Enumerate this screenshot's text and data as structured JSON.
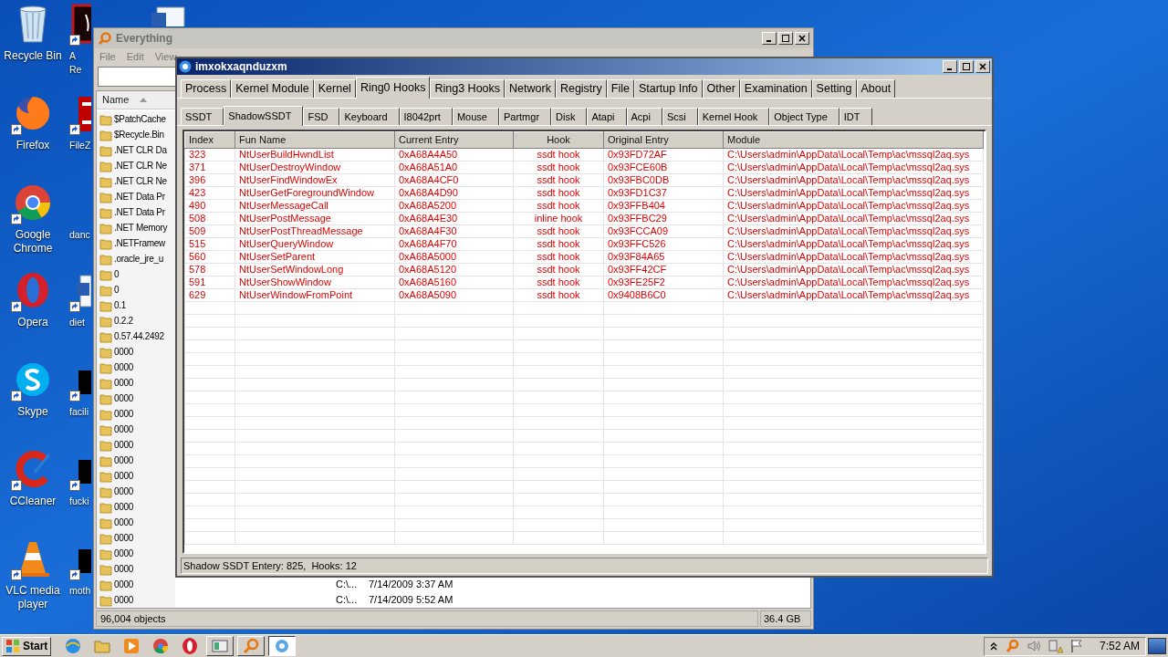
{
  "desktop_icons": [
    {
      "lines": [
        "Recycle Bin"
      ]
    },
    {
      "lines": [
        "Firefox"
      ]
    },
    {
      "lines": [
        "Google",
        "Chrome"
      ]
    },
    {
      "lines": [
        "Opera"
      ]
    },
    {
      "lines": [
        "Skype"
      ]
    },
    {
      "lines": [
        "CCleaner"
      ]
    },
    {
      "lines": [
        "VLC media",
        "player"
      ]
    },
    {
      "lines": [
        "A",
        "Re"
      ]
    },
    {
      "lines": [
        "FileZ"
      ]
    },
    {
      "lines": [
        "danc"
      ]
    },
    {
      "lines": [
        "diet"
      ]
    },
    {
      "lines": [
        "facili"
      ]
    },
    {
      "lines": [
        "fucki"
      ]
    },
    {
      "lines": [
        "moth"
      ]
    }
  ],
  "everything": {
    "title": "Everything",
    "menu": [
      "File",
      "Edit",
      "View"
    ],
    "column": "Name",
    "rows": [
      {
        "name": "$PatchCache"
      },
      {
        "name": "$Recycle.Bin"
      },
      {
        "name": ".NET CLR Da"
      },
      {
        "name": ".NET CLR Ne"
      },
      {
        "name": ".NET CLR Ne"
      },
      {
        "name": ".NET Data Pr"
      },
      {
        "name": ".NET Data Pr"
      },
      {
        "name": ".NET Memory"
      },
      {
        "name": ".NETFramew"
      },
      {
        "name": ".oracle_jre_u"
      },
      {
        "name": "0"
      },
      {
        "name": "0"
      },
      {
        "name": "0.1"
      },
      {
        "name": "0.2.2"
      },
      {
        "name": "0.57.44.2492"
      },
      {
        "name": "0000"
      },
      {
        "name": "0000"
      },
      {
        "name": "0000"
      },
      {
        "name": "0000"
      },
      {
        "name": "0000"
      },
      {
        "name": "0000"
      },
      {
        "name": "0000"
      },
      {
        "name": "0000"
      },
      {
        "name": "0000"
      },
      {
        "name": "0000"
      },
      {
        "name": "0000"
      },
      {
        "name": "0000"
      },
      {
        "name": "0000"
      },
      {
        "name": "0000"
      },
      {
        "name": "0000"
      },
      {
        "name": "0000",
        "path": "C:\\...",
        "date": "7/14/2009 3:37 AM"
      },
      {
        "name": "0000",
        "path": "C:\\...",
        "date": "7/14/2009 5:52 AM"
      }
    ],
    "status": "96,004 objects",
    "size": "36.4 GB"
  },
  "tool": {
    "title": "imxokxaqnduzxm",
    "tabs": [
      {
        "label": "Process",
        "selected": false
      },
      {
        "label": "Kernel Module",
        "selected": false
      },
      {
        "label": "Kernel",
        "selected": false
      },
      {
        "label": "Ring0 Hooks",
        "selected": true
      },
      {
        "label": "Ring3 Hooks",
        "selected": false
      },
      {
        "label": "Network",
        "selected": false
      },
      {
        "label": "Registry",
        "selected": false
      },
      {
        "label": "File",
        "selected": false
      },
      {
        "label": "Startup Info",
        "selected": false
      },
      {
        "label": "Other",
        "selected": false
      },
      {
        "label": "Examination",
        "selected": false
      },
      {
        "label": "Setting",
        "selected": false
      },
      {
        "label": "About",
        "selected": false
      }
    ],
    "subtabs": [
      {
        "label": "SSDT",
        "selected": false
      },
      {
        "label": "ShadowSSDT",
        "selected": true
      },
      {
        "label": "FSD",
        "selected": false
      },
      {
        "label": "Keyboard",
        "selected": false
      },
      {
        "label": "I8042prt",
        "selected": false
      },
      {
        "label": "Mouse",
        "selected": false
      },
      {
        "label": "Partmgr",
        "selected": false
      },
      {
        "label": "Disk",
        "selected": false
      },
      {
        "label": "Atapi",
        "selected": false
      },
      {
        "label": "Acpi",
        "selected": false
      },
      {
        "label": "Scsi",
        "selected": false
      },
      {
        "label": "Kernel Hook",
        "selected": false
      },
      {
        "label": "Object Type",
        "selected": false
      },
      {
        "label": "IDT",
        "selected": false
      }
    ],
    "columns": [
      "Index",
      "Fun Name",
      "Current Entry",
      "Hook",
      "Original Entry",
      "Module"
    ],
    "rows": [
      [
        "323",
        "NtUserBuildHwndList",
        "0xA68A4A50",
        "ssdt hook",
        "0x93FD72AF",
        "C:\\Users\\admin\\AppData\\Local\\Temp\\ac\\mssql2aq.sys"
      ],
      [
        "371",
        "NtUserDestroyWindow",
        "0xA68A51A0",
        "ssdt hook",
        "0x93FCE60B",
        "C:\\Users\\admin\\AppData\\Local\\Temp\\ac\\mssql2aq.sys"
      ],
      [
        "396",
        "NtUserFindWindowEx",
        "0xA68A4CF0",
        "ssdt hook",
        "0x93FBC0DB",
        "C:\\Users\\admin\\AppData\\Local\\Temp\\ac\\mssql2aq.sys"
      ],
      [
        "423",
        "NtUserGetForegroundWindow",
        "0xA68A4D90",
        "ssdt hook",
        "0x93FD1C37",
        "C:\\Users\\admin\\AppData\\Local\\Temp\\ac\\mssql2aq.sys"
      ],
      [
        "490",
        "NtUserMessageCall",
        "0xA68A5200",
        "ssdt hook",
        "0x93FFB404",
        "C:\\Users\\admin\\AppData\\Local\\Temp\\ac\\mssql2aq.sys"
      ],
      [
        "508",
        "NtUserPostMessage",
        "0xA68A4E30",
        "inline hook",
        "0x93FFBC29",
        "C:\\Users\\admin\\AppData\\Local\\Temp\\ac\\mssql2aq.sys"
      ],
      [
        "509",
        "NtUserPostThreadMessage",
        "0xA68A4F30",
        "ssdt hook",
        "0x93FCCA09",
        "C:\\Users\\admin\\AppData\\Local\\Temp\\ac\\mssql2aq.sys"
      ],
      [
        "515",
        "NtUserQueryWindow",
        "0xA68A4F70",
        "ssdt hook",
        "0x93FFC526",
        "C:\\Users\\admin\\AppData\\Local\\Temp\\ac\\mssql2aq.sys"
      ],
      [
        "560",
        "NtUserSetParent",
        "0xA68A5000",
        "ssdt hook",
        "0x93F84A65",
        "C:\\Users\\admin\\AppData\\Local\\Temp\\ac\\mssql2aq.sys"
      ],
      [
        "578",
        "NtUserSetWindowLong",
        "0xA68A5120",
        "ssdt hook",
        "0x93FF42CF",
        "C:\\Users\\admin\\AppData\\Local\\Temp\\ac\\mssql2aq.sys"
      ],
      [
        "591",
        "NtUserShowWindow",
        "0xA68A5160",
        "ssdt hook",
        "0x93FE25F2",
        "C:\\Users\\admin\\AppData\\Local\\Temp\\ac\\mssql2aq.sys"
      ],
      [
        "629",
        "NtUserWindowFromPoint",
        "0xA68A5090",
        "ssdt hook",
        "0x9408B6C0",
        "C:\\Users\\admin\\AppData\\Local\\Temp\\ac\\mssql2aq.sys"
      ]
    ],
    "status": "Shadow SSDT Entery: 825,  Hooks: 12"
  },
  "taskbar": {
    "start": "Start",
    "apps": [
      {
        "running": false,
        "selected": false
      },
      {
        "running": false,
        "selected": false
      },
      {
        "running": false,
        "selected": false
      },
      {
        "running": false,
        "selected": false
      },
      {
        "running": false,
        "selected": false
      },
      {
        "running": true,
        "selected": false
      },
      {
        "running": true,
        "selected": false
      },
      {
        "running": true,
        "selected": true
      }
    ],
    "clock": "7:52 AM"
  }
}
